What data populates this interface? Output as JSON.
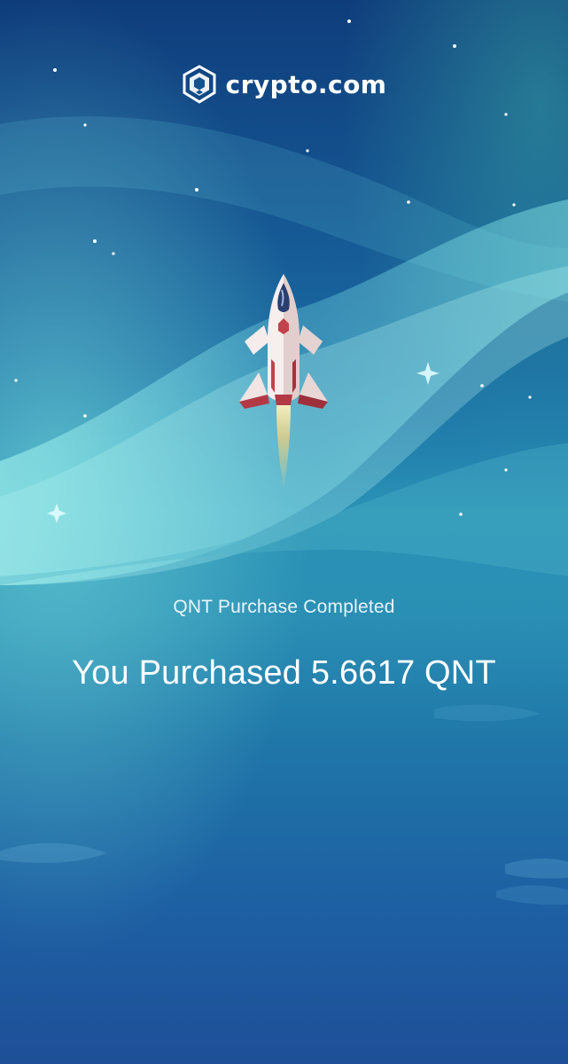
{
  "brand": {
    "name": "crypto.com",
    "logo_icon": "crypto-com-lion-shield-icon"
  },
  "illustration": {
    "subject": "rocket-icon",
    "background": "aurora-night-sky"
  },
  "status": {
    "subtitle": "QNT Purchase Completed",
    "headline": "You Purchased 5.6617 QNT"
  },
  "colors": {
    "sky_top": "#0f3d7c",
    "sky_mid": "#2a92b6",
    "sky_bottom": "#1e4f98",
    "text": "#ffffff",
    "rocket_accent": "#c2434a"
  }
}
